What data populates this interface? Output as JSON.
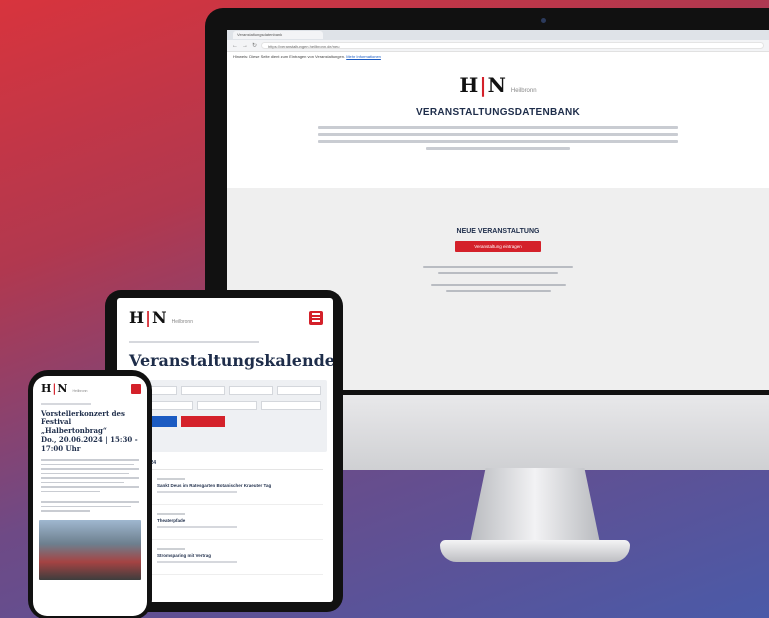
{
  "desktop": {
    "browser_tab": "Veranstaltungsdatenbank",
    "url": "https://veranstaltungen.heilbronn.de/neu",
    "notice_text": "Hinweis: Diese Seite dient zum Eintragen von Veranstaltungen.",
    "notice_link": "Mehr Informationen",
    "logo_mark_left": "H",
    "logo_mark_bar": "|",
    "logo_mark_right": "N",
    "logo_sub": "Heilbronn",
    "page_title": "VERANSTALTUNGSDATENBANK",
    "new_event_title": "NEUE VERANSTALTUNG",
    "new_event_button": "Veranstaltung eintragen"
  },
  "tablet": {
    "logo_mark_left": "H",
    "logo_mark_bar": "|",
    "logo_mark_right": "N",
    "logo_sub": "Heilbronn",
    "page_title": "Veranstaltungskalender",
    "date_heading": "20.06.2024",
    "events": [
      {
        "name": "Sankt Deus im Ratesgarten Botanischer Kraeuter Tag"
      },
      {
        "name": "Theaterpfade"
      },
      {
        "name": "Stromsparing mit Vertrag"
      }
    ]
  },
  "phone": {
    "logo_mark_left": "H",
    "logo_mark_bar": "|",
    "logo_mark_right": "N",
    "logo_sub": "Heilbronn",
    "title_line1": "Vorstellerkonzert des Festival",
    "title_line2": "„Halbertonbrag“",
    "title_line3": "Do., 20.06.2024 | 15:30 - 17:00 Uhr"
  },
  "colors": {
    "brand_red": "#d4212a",
    "brand_navy": "#1e2d4a",
    "link_blue": "#1b5bc2"
  }
}
